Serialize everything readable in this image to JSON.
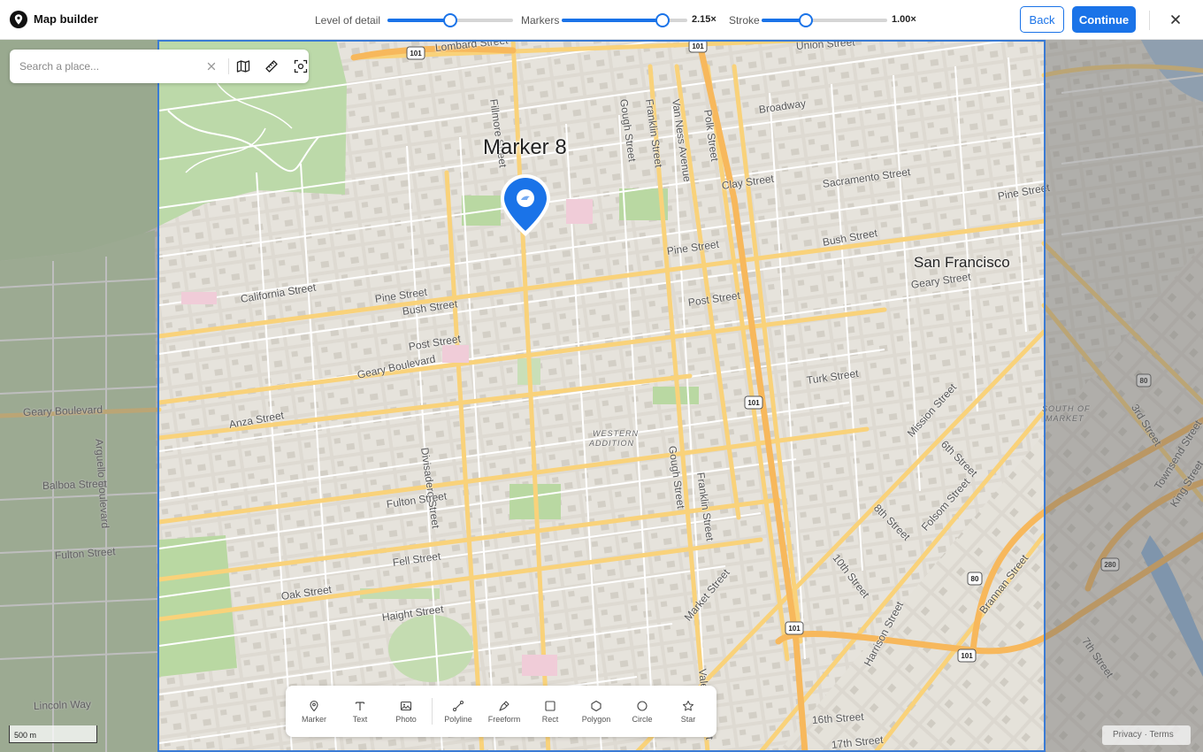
{
  "header": {
    "app_title": "Map builder",
    "controls": [
      {
        "label": "Level of detail",
        "fraction": 0.5,
        "value": ""
      },
      {
        "label": "Markers",
        "fraction": 0.8,
        "value": "2.15×"
      },
      {
        "label": "Stroke",
        "fraction": 0.35,
        "value": "1.00×"
      }
    ],
    "back_label": "Back",
    "continue_label": "Continue"
  },
  "search": {
    "placeholder": "Search a place..."
  },
  "marker": {
    "title": "Marker 8",
    "color": "#1a73e8"
  },
  "accent_color": "#1a73e8",
  "map_labels": {
    "city": "San Francisco",
    "western_addition_1": "WESTERN",
    "western_addition_2": "ADDITION",
    "south_of_market_1": "SOUTH OF",
    "south_of_market_2": "MARKET",
    "streets": [
      "Lombard Street",
      "Union Street",
      "Broadway",
      "Fillmore Street",
      "Gough Street",
      "Franklin Street",
      "Van Ness Avenue",
      "Polk Street",
      "Clay Street",
      "Sacramento Street",
      "Pine Street",
      "Bush Street",
      "Pine Street",
      "Bush Street",
      "Pine Street",
      "Geary Street",
      "California Street",
      "Post Street",
      "Post Street",
      "Geary Boulevard",
      "Turk Street",
      "Anza Street",
      "Geary Boulevard",
      "Arguello Boulevard",
      "Divisadero Street",
      "Gough Street",
      "Franklin Street",
      "Mission Street",
      "6th Street",
      "Balboa Street",
      "Fulton Street",
      "8th Street",
      "Folsom Street",
      "Fulton Street",
      "Fell Street",
      "10th Street",
      "Market Street",
      "Oak Street",
      "Haight Street",
      "Brannan Street",
      "Harrison Street",
      "Valencia Street",
      "7th Street",
      "3rd Street",
      "Townsend Street",
      "King Street",
      "Lincoln Way",
      "16th Street",
      "17th Street"
    ],
    "shields": [
      "101",
      "101",
      "101",
      "101",
      "101",
      "80",
      "80",
      "280"
    ]
  },
  "tools": [
    {
      "name": "marker",
      "label": "Marker"
    },
    {
      "name": "text",
      "label": "Text"
    },
    {
      "name": "photo",
      "label": "Photo"
    },
    {
      "name": "polyline",
      "label": "Polyline"
    },
    {
      "name": "freeform",
      "label": "Freeform"
    },
    {
      "name": "rect",
      "label": "Rect"
    },
    {
      "name": "polygon",
      "label": "Polygon"
    },
    {
      "name": "circle",
      "label": "Circle"
    },
    {
      "name": "star",
      "label": "Star"
    }
  ],
  "scale": "500 m",
  "footer": {
    "privacy": "Privacy",
    "separator": "·",
    "terms": "Terms"
  }
}
